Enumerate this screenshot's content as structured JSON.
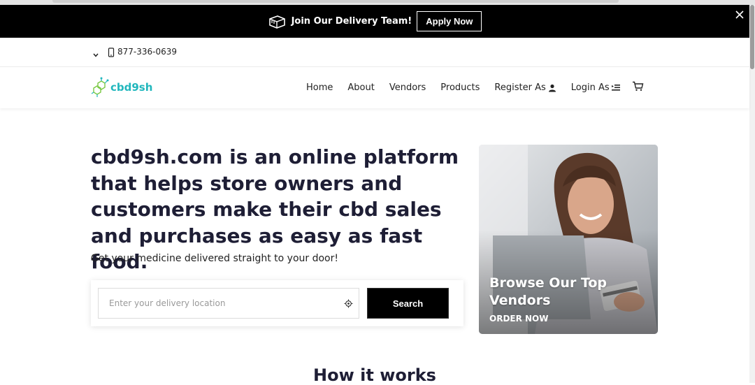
{
  "promo_bar": {
    "label": "Join Our Delivery Team!",
    "apply_label": "Apply Now"
  },
  "contact": {
    "phone": "877-336-0639"
  },
  "logo": {
    "text": "cbd9sh"
  },
  "nav": {
    "items": [
      {
        "label": "Home"
      },
      {
        "label": "About"
      },
      {
        "label": "Vendors"
      },
      {
        "label": "Products"
      },
      {
        "label": "Register As"
      },
      {
        "label": "Login As"
      }
    ]
  },
  "hero": {
    "title": "cbd9sh.com is an online platform that helps store owners and customers make their cbd sales and purchases as easy as fast food.",
    "subtitle": "Get your medicine delivered straight to your door!",
    "search_placeholder": "Enter your delivery location",
    "search_button": "Search"
  },
  "promo_card": {
    "title": "Browse Our Top Vendors",
    "link": "ORDER NOW"
  },
  "section": {
    "heading": "How it works"
  },
  "colors": {
    "brand": "#21b7bd",
    "dark": "#1e1e35",
    "promo_bg": "#000000"
  }
}
